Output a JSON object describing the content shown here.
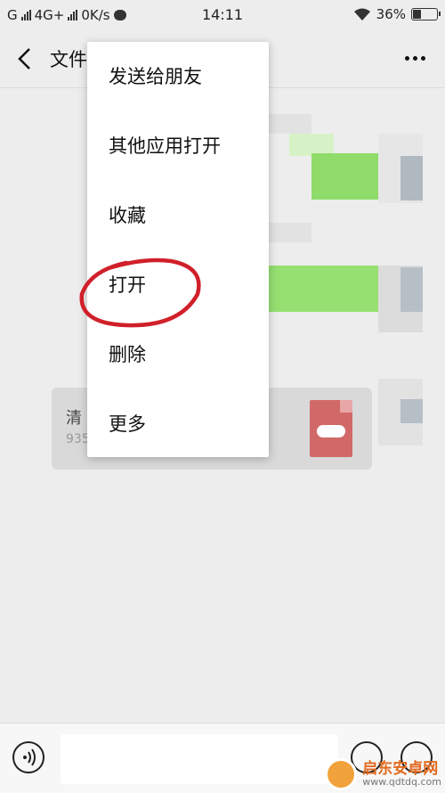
{
  "status_bar": {
    "carrier1": "G",
    "carrier2": "4G+",
    "speed": "0K/s",
    "time": "14:11",
    "battery": "36%",
    "battery_level": 0.36
  },
  "nav": {
    "title": "文件"
  },
  "file_card": {
    "name": "清",
    "size": "935"
  },
  "popup_menu": {
    "items": [
      {
        "label": "发送给朋友"
      },
      {
        "label": "其他应用打开"
      },
      {
        "label": "收藏"
      },
      {
        "label": "打开"
      },
      {
        "label": "删除"
      },
      {
        "label": "更多"
      }
    ]
  },
  "annotation": {
    "color": "#d0202a"
  },
  "watermark": {
    "text": "启东安卓网",
    "url": "www.qdtdq.com"
  }
}
